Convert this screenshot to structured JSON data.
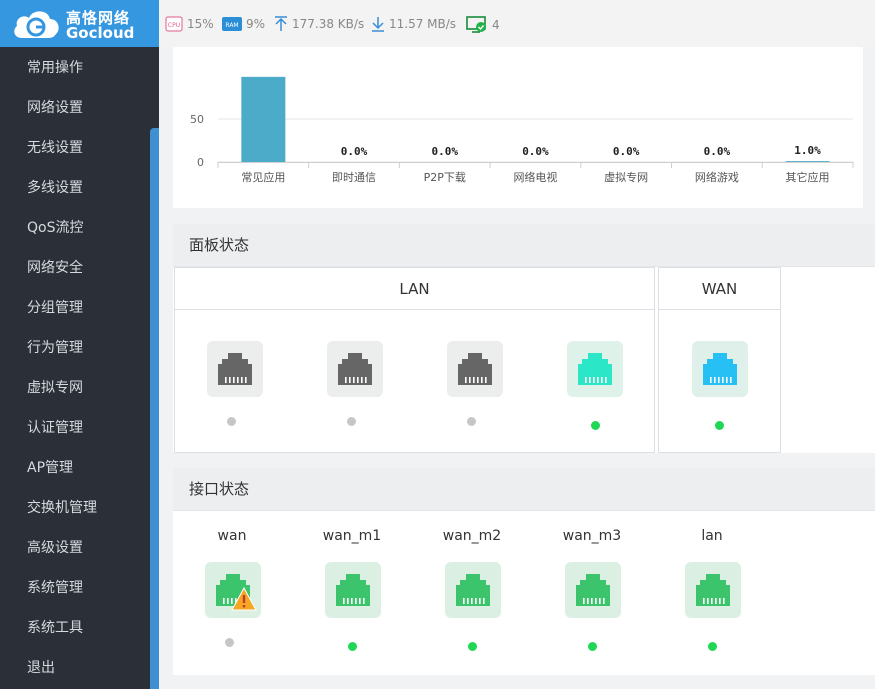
{
  "brand": {
    "cn": "高恪网络",
    "en": "Gocloud"
  },
  "menu": [
    "常用操作",
    "网络设置",
    "无线设置",
    "多线设置",
    "QoS流控",
    "网络安全",
    "分组管理",
    "行为管理",
    "虚拟专网",
    "认证管理",
    "AP管理",
    "交换机管理",
    "高级设置",
    "系统管理",
    "系统工具",
    "退出"
  ],
  "status": {
    "cpu_label": "CPU",
    "cpu": "15%",
    "ram_label": "RAM",
    "ram": "9%",
    "upload": "177.38 KB/s",
    "download": "11.57 MB/s",
    "devices": "4"
  },
  "chart_data": {
    "type": "bar",
    "categories": [
      "常见应用",
      "即时通信",
      "P2P下载",
      "网络电视",
      "虚拟专网",
      "网络游戏",
      "其它应用"
    ],
    "values": [
      99.0,
      0.0,
      0.0,
      0.0,
      0.0,
      0.0,
      1.0
    ],
    "data_labels": [
      "",
      "0.0%",
      "0.0%",
      "0.0%",
      "0.0%",
      "0.0%",
      "1.0%"
    ],
    "yticks": [
      "0",
      "50"
    ],
    "ylim": [
      0,
      100
    ],
    "color": "#4babc9"
  },
  "panel": {
    "title": "面板状态",
    "lan_title": "LAN",
    "wan_title": "WAN",
    "lan_ports": [
      {
        "state": "inactive",
        "led": "off"
      },
      {
        "state": "inactive",
        "led": "off"
      },
      {
        "state": "inactive",
        "led": "off"
      },
      {
        "state": "active",
        "led": "on"
      }
    ],
    "wan_ports": [
      {
        "state": "active",
        "led": "on"
      }
    ]
  },
  "interfaces": {
    "title": "接口状态",
    "items": [
      {
        "name": "wan",
        "warning": true,
        "led": "off"
      },
      {
        "name": "wan_m1",
        "warning": false,
        "led": "on"
      },
      {
        "name": "wan_m2",
        "warning": false,
        "led": "on"
      },
      {
        "name": "wan_m3",
        "warning": false,
        "led": "on"
      },
      {
        "name": "lan",
        "warning": false,
        "led": "on"
      }
    ]
  },
  "colors": {
    "led_on": "#1fd655",
    "led_off": "#c4c6c8",
    "port_inactive": "#666666",
    "lan_active": "#2ce7c7",
    "wan_active": "#27c0f5",
    "iface_port": "#3cc46c",
    "warning": "#f5a623"
  }
}
